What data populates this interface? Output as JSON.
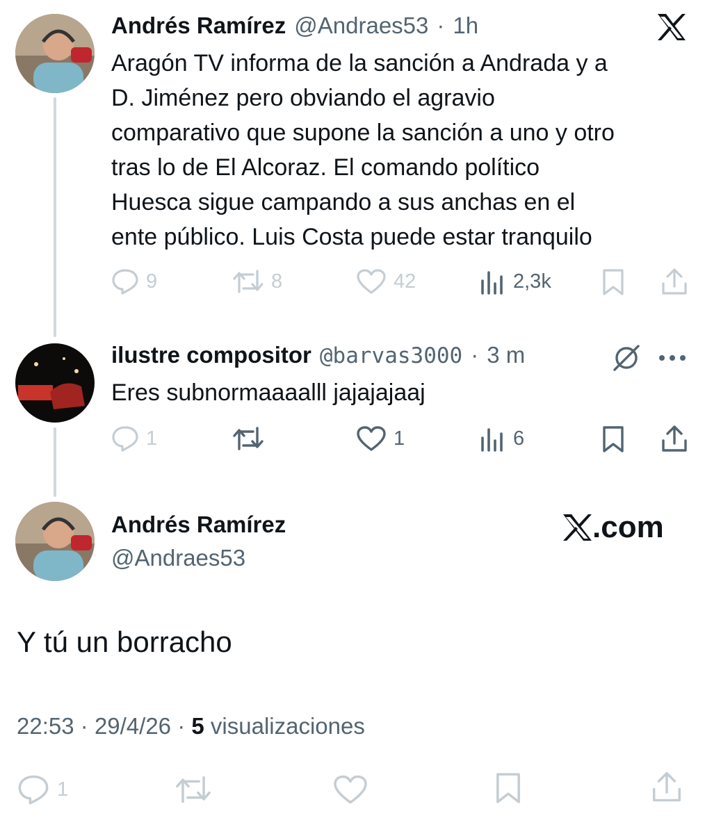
{
  "tweet1": {
    "name": "Andrés Ramírez",
    "handle": "@Andraes53",
    "dot": "·",
    "time": "1h",
    "lines": [
      "Aragón TV informa de la sanción a Andrada y a",
      "D. Jiménez pero obviando el agravio",
      "comparativo que supone la sanción a uno y otro",
      "tras lo de El Alcoraz. El comando político",
      "Huesca sigue campando a sus anchas en el",
      "ente público. Luis Costa puede estar tranquilo"
    ],
    "replies": "9",
    "retweets": "8",
    "likes": "42",
    "views": "2,3k"
  },
  "tweet2": {
    "name": "ilustre compositor",
    "handle": "@barvas3000",
    "dot": "·",
    "time": "3 m",
    "text": "Eres subnormaaaalll jajajajaaj",
    "replies": "1",
    "likes": "1",
    "views": "6"
  },
  "tweet3": {
    "name": "Andrés Ramírez",
    "handle": "@Andraes53",
    "text": "Y tú un borracho",
    "time": "22:53",
    "dot": "·",
    "date": "29/4/26",
    "views_count": "5",
    "views_label": "visualizaciones",
    "replies": "1"
  },
  "brand": {
    "watermark": "X.com",
    "logo_letter": "X"
  },
  "colors": {
    "text": "#0f1419",
    "secondary": "#536471",
    "faded": "#c4cdd3",
    "thread_line": "#cfd9de"
  }
}
